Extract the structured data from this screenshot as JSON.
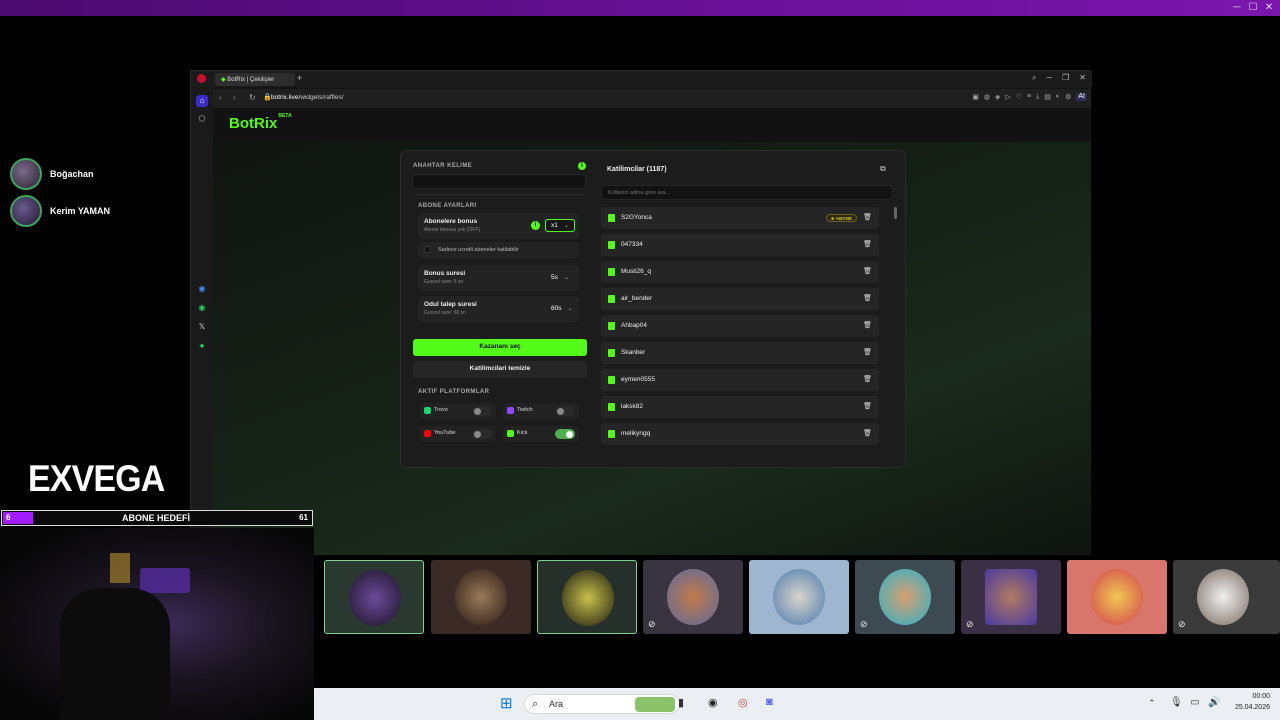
{
  "viewers": [
    {
      "name": "Boğachan"
    },
    {
      "name": "Kerim YAMAN"
    }
  ],
  "browser": {
    "tab_title": "BotRix | Çekilişler",
    "url_host": "botrix.live",
    "url_path": "/widgets/raffles/",
    "ai_label": "AI"
  },
  "app": {
    "logo": "BotRix",
    "logo_badge": "BETA"
  },
  "settings": {
    "keyword_label": "ANAHTAR KELIME",
    "keyword_value": "",
    "sub_settings_label": "ABONE AYARLARI",
    "sub_bonus_title": "Abonelere bonus",
    "sub_bonus_sub": "Abone bonusu yok (OFF)",
    "sub_bonus_value": "x1",
    "only_paid_label": "Sadece ucretli aboneler katilabilir",
    "bonus_time_title": "Bonus suresi",
    "bonus_time_sub": "Guncel sure: 5 sn",
    "bonus_time_value": "5s",
    "claim_time_title": "Odul talep suresi",
    "claim_time_sub": "Guncel sure: 60 sn",
    "claim_time_value": "60s",
    "pick_winner_button": "Kazananı seç",
    "clear_button": "Katilimcilari temizle",
    "platforms_label": "AKTIF PLATFORMLAR",
    "platforms": [
      {
        "name": "Trovo",
        "enabled": false,
        "color": "#19d66b"
      },
      {
        "name": "Twitch",
        "enabled": false,
        "color": "#9146ff"
      },
      {
        "name": "YouTube",
        "enabled": false,
        "color": "#ff0000"
      },
      {
        "name": "Kick",
        "enabled": true,
        "color": "#53fc18"
      }
    ]
  },
  "participants": {
    "title": "Katilimcilar (1187)",
    "search_placeholder": "Kullanici adina gore ara...",
    "sub_badge": "ABONE",
    "rows": [
      "S2GYonca",
      "047334",
      "Musti26_q",
      "air_bender",
      "Ahbap04",
      "Skanber",
      "eymen0555",
      "laksk82",
      "melikyngq"
    ]
  },
  "overlay": {
    "brand": "EXVEGA",
    "goal_current": "6",
    "goal_label": "ABONE HEDEFİ",
    "goal_target": "61",
    "goal_progress": 0.098
  },
  "taskbar": {
    "search_placeholder": "Ara",
    "time": "00:00",
    "date": "25.04.2026"
  },
  "colors": {
    "kick_green": "#53fc18",
    "goal_purple": "#a21cff",
    "title_purple": "#6a1199"
  }
}
